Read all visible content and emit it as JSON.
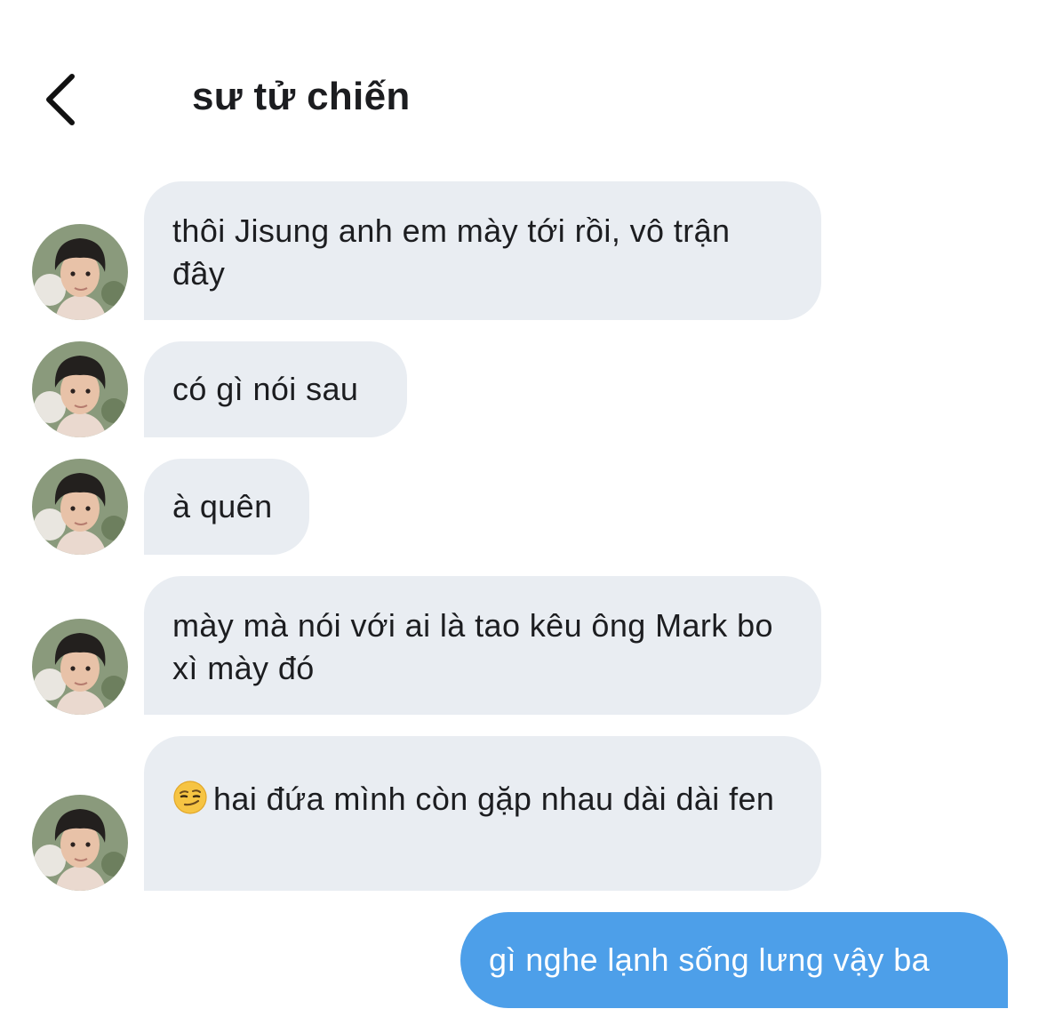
{
  "header": {
    "title": "sư tử chiến"
  },
  "messages": [
    {
      "from": "them",
      "text": "thôi Jisung anh em mày tới rồi, vô trận đây"
    },
    {
      "from": "them",
      "text": "có gì nói sau"
    },
    {
      "from": "them",
      "text": "à quên"
    },
    {
      "from": "them",
      "text": "mày mà nói với ai là tao kêu ông Mark bo xì mày đó"
    },
    {
      "from": "them",
      "emoji": "smirking-face-icon",
      "text": "hai đứa mình còn gặp nhau dài dài fen"
    },
    {
      "from": "me",
      "text": "gì nghe lạnh sống lưng vậy ba"
    }
  ],
  "colors": {
    "incoming_bubble": "#e9edf2",
    "outgoing_bubble": "#4d9fe9",
    "text": "#1c1d20",
    "outgoing_text": "#ffffff"
  }
}
